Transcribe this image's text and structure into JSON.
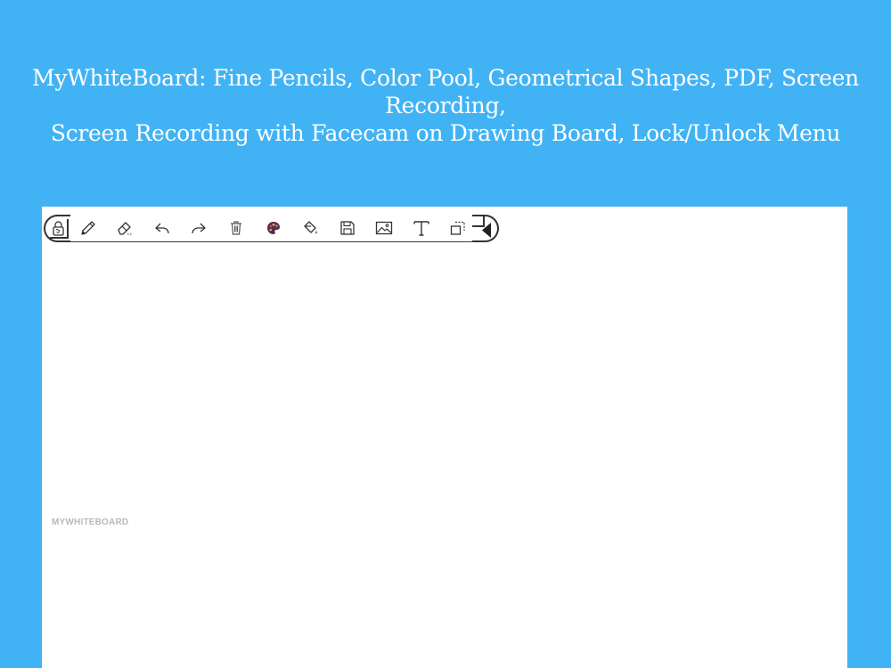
{
  "caption": {
    "line1": "MyWhiteBoard: Fine Pencils, Color Pool, Geometrical Shapes, PDF, Screen Recording,",
    "line2": "Screen Recording with Facecam on Drawing Board, Lock/Unlock Menu"
  },
  "toolbar": {
    "tools": [
      {
        "icon": "lock-icon"
      },
      {
        "icon": "pencil-icon"
      },
      {
        "icon": "eraser-icon"
      },
      {
        "icon": "undo-icon"
      },
      {
        "icon": "redo-icon"
      },
      {
        "icon": "trash-icon"
      },
      {
        "icon": "color-palette-icon"
      },
      {
        "icon": "paint-bucket-icon"
      },
      {
        "icon": "save-icon"
      },
      {
        "icon": "image-icon"
      },
      {
        "icon": "text-icon"
      },
      {
        "icon": "crop-icon"
      },
      {
        "icon": "collapse-menu-icon"
      }
    ]
  },
  "canvas": {
    "watermark": "MYWHITEBOARD"
  },
  "colors": {
    "background": "#41b3f5",
    "canvas": "#ffffff",
    "icon_stroke": "#333333",
    "palette_fill": "#5e2a45",
    "watermark": "#b9b9b9"
  }
}
